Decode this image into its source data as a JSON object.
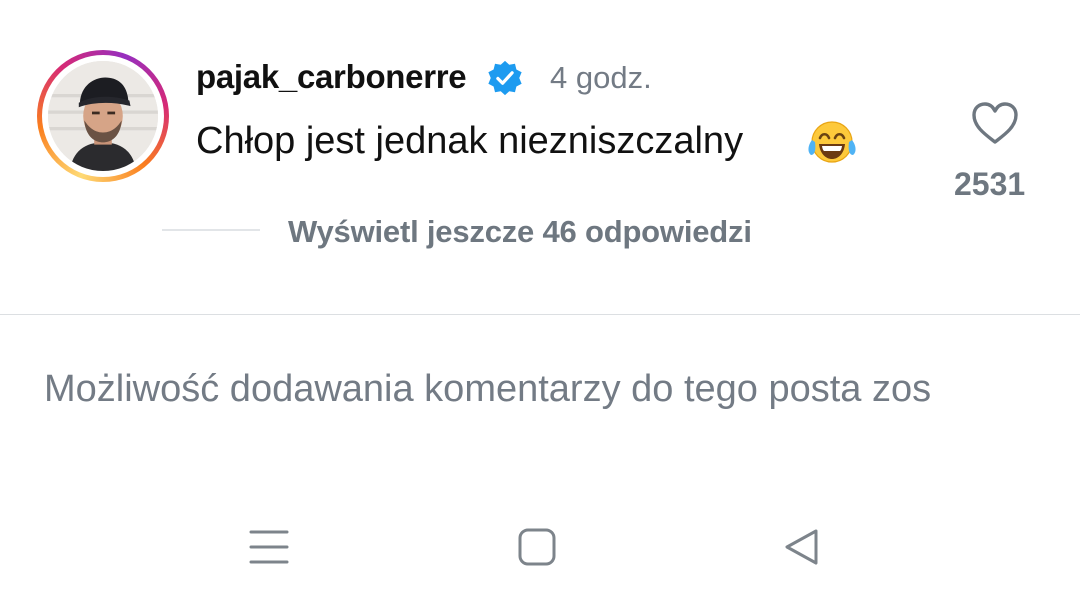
{
  "comment": {
    "username": "pajak_carbonerre",
    "time": "4 godz.",
    "text": "Chłop jest jednak niezniszczalny",
    "emoji": "face-with-tears-of-joy",
    "like_count": "2531",
    "replies_label": "Wyświetl jeszcze 46 odpowiedzi"
  },
  "footer": {
    "comments_disabled_text": "Możliwość dodawania komentarzy do tego posta zos"
  },
  "icons": {
    "verified": "verified-badge-icon",
    "like": "heart-icon",
    "nav_menu": "recent-apps-icon",
    "nav_home": "home-icon",
    "nav_back": "back-icon"
  },
  "colors": {
    "verified_blue": "#1d9bf0",
    "muted_text": "#737b85",
    "divider": "#dcdfe2"
  }
}
